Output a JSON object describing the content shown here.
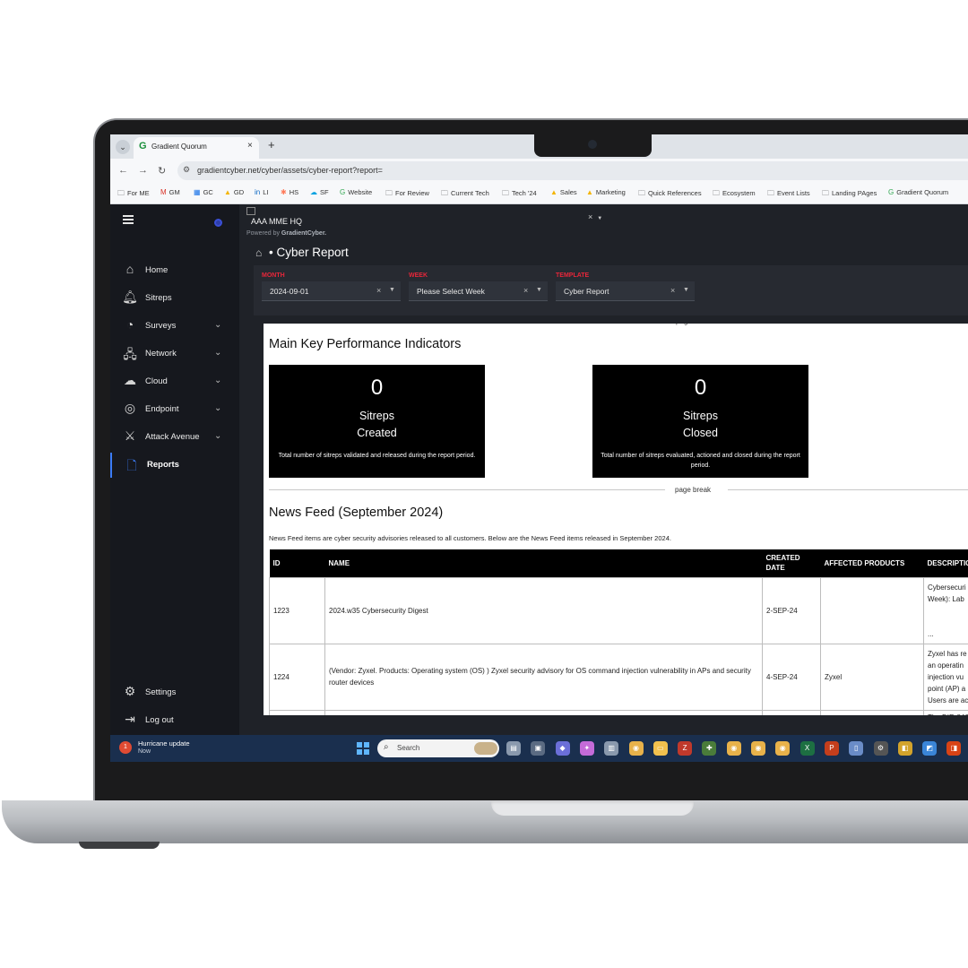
{
  "browser": {
    "tab_title": "Gradient Quorum",
    "tab_close": "×",
    "new_tab": "+",
    "url": "gradientcyber.net/cyber/assets/cyber-report?report=",
    "bookmarks": [
      {
        "icon": "folder-icon",
        "label": "For ME"
      },
      {
        "icon": "gmail-icon",
        "label": "GM"
      },
      {
        "icon": "calendar-icon",
        "label": "GC"
      },
      {
        "icon": "drive-icon",
        "label": "GD"
      },
      {
        "icon": "linkedin-icon",
        "label": "LI"
      },
      {
        "icon": "hubspot-icon",
        "label": "HS"
      },
      {
        "icon": "salesforce-icon",
        "label": "SF"
      },
      {
        "icon": "google-icon",
        "label": "Website"
      },
      {
        "icon": "folder-icon",
        "label": "For Review"
      },
      {
        "icon": "folder-icon",
        "label": "Current Tech"
      },
      {
        "icon": "folder-icon",
        "label": "Tech '24"
      },
      {
        "icon": "drive-icon",
        "label": "Sales"
      },
      {
        "icon": "drive-icon",
        "label": "Marketing"
      },
      {
        "icon": "folder-icon",
        "label": "Quick References"
      },
      {
        "icon": "folder-icon",
        "label": "Ecosystem"
      },
      {
        "icon": "folder-icon",
        "label": "Event Lists"
      },
      {
        "icon": "folder-icon",
        "label": "Landing PAges"
      },
      {
        "icon": "google-icon",
        "label": "Gradient Quorum"
      }
    ]
  },
  "sidebar": {
    "items": [
      {
        "icon": "home-icon",
        "label": "Home",
        "chevron": false
      },
      {
        "icon": "bell-icon",
        "label": "Sitreps",
        "chevron": false
      },
      {
        "icon": "gauge-icon",
        "label": "Surveys",
        "chevron": true
      },
      {
        "icon": "network-icon",
        "label": "Network",
        "chevron": true
      },
      {
        "icon": "cloud-icon",
        "label": "Cloud",
        "chevron": true
      },
      {
        "icon": "target-icon",
        "label": "Endpoint",
        "chevron": true
      },
      {
        "icon": "attack-icon",
        "label": "Attack Avenue",
        "chevron": true
      },
      {
        "icon": "document-icon",
        "label": "Reports",
        "chevron": false,
        "active": true
      }
    ],
    "bottom": [
      {
        "icon": "gear-icon",
        "label": "Settings"
      },
      {
        "icon": "logout-icon",
        "label": "Log out"
      }
    ]
  },
  "header": {
    "site_name": "AAA MME HQ",
    "powered_prefix": "Powered by ",
    "powered_brand": "GradientCyber.",
    "breadcrumb_sep": "•",
    "page_title": "Cyber Report"
  },
  "filters": {
    "month": {
      "label": "MONTH",
      "value": "2024-09-01"
    },
    "week": {
      "label": "WEEK",
      "value": "Please Select Week"
    },
    "template": {
      "label": "TEMPLATE",
      "value": "Cyber Report"
    },
    "clear": "×",
    "caret": "▼"
  },
  "report": {
    "page_break_label": "page break",
    "kpi_title": "Main Key Performance Indicators",
    "kpis": [
      {
        "value": "0",
        "label_line1": "Sitreps",
        "label_line2": "Created",
        "desc": "Total number of sitreps validated and released during the report period."
      },
      {
        "value": "0",
        "label_line1": "Sitreps",
        "label_line2": "Closed",
        "desc": "Total number of sitreps evaluated, actioned and closed during the report period."
      }
    ],
    "news_title": "News Feed (September 2024)",
    "news_desc": "News Feed items are cyber security advisories released to all customers. Below are the News Feed items released in September 2024.",
    "columns": [
      "ID",
      "NAME",
      "CREATED DATE",
      "AFFECTED PRODUCTS",
      "DESCRIPTIO"
    ],
    "rows": [
      {
        "id": "1223",
        "name": "2024.w35 Cybersecurity Digest",
        "date": "2-SEP-24",
        "products": "",
        "desc": "Cybersecuri\nWeek): Lab\n\n\n..."
      },
      {
        "id": "1224",
        "name": "(Vendor: Zyxel. Products: Operating system (OS) ) Zyxel security advisory for OS command injection vulnerability in APs and security router devices",
        "date": "4-SEP-24",
        "products": "Zyxel",
        "desc": "Zyxel has re\nan operatin\ninjection vu\npoint (AP) a\nUsers are ac"
      },
      {
        "id": "",
        "name": "",
        "date": "",
        "products": "",
        "desc": "The DIR-846"
      }
    ]
  },
  "taskbar": {
    "notification_title": "Hurricane update",
    "notification_time": "Now",
    "notification_count": "1",
    "search_placeholder": "Search",
    "icons": [
      "file-explorer-icon",
      "app-icon",
      "teams-icon",
      "copilot-icon",
      "app-icon",
      "chrome-icon",
      "folder-icon",
      "zoom-icon",
      "app-icon",
      "chrome-icon",
      "chrome-icon",
      "chrome-icon",
      "excel-icon",
      "powerpoint-icon",
      "app-icon",
      "settings-icon",
      "app-icon",
      "app-icon",
      "app-icon"
    ]
  }
}
